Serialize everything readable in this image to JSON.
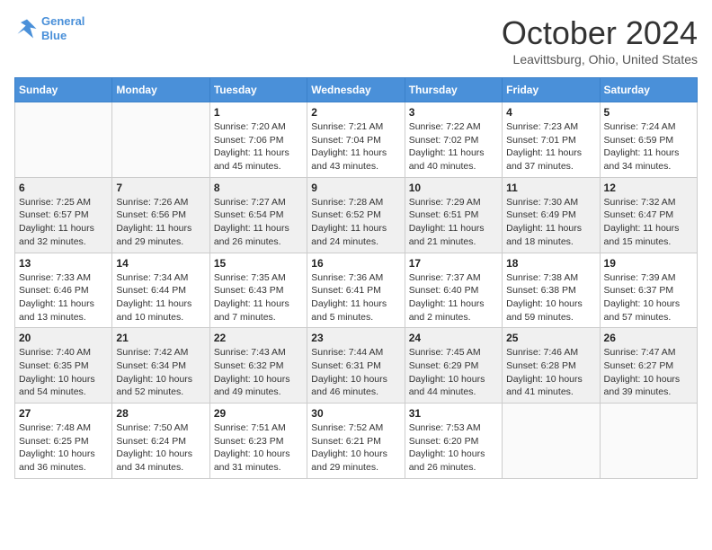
{
  "header": {
    "logo_line1": "General",
    "logo_line2": "Blue",
    "month_title": "October 2024",
    "location": "Leavittsburg, Ohio, United States"
  },
  "days_of_week": [
    "Sunday",
    "Monday",
    "Tuesday",
    "Wednesday",
    "Thursday",
    "Friday",
    "Saturday"
  ],
  "weeks": [
    [
      {
        "day": "",
        "info": ""
      },
      {
        "day": "",
        "info": ""
      },
      {
        "day": "1",
        "info": "Sunrise: 7:20 AM\nSunset: 7:06 PM\nDaylight: 11 hours and 45 minutes."
      },
      {
        "day": "2",
        "info": "Sunrise: 7:21 AM\nSunset: 7:04 PM\nDaylight: 11 hours and 43 minutes."
      },
      {
        "day": "3",
        "info": "Sunrise: 7:22 AM\nSunset: 7:02 PM\nDaylight: 11 hours and 40 minutes."
      },
      {
        "day": "4",
        "info": "Sunrise: 7:23 AM\nSunset: 7:01 PM\nDaylight: 11 hours and 37 minutes."
      },
      {
        "day": "5",
        "info": "Sunrise: 7:24 AM\nSunset: 6:59 PM\nDaylight: 11 hours and 34 minutes."
      }
    ],
    [
      {
        "day": "6",
        "info": "Sunrise: 7:25 AM\nSunset: 6:57 PM\nDaylight: 11 hours and 32 minutes."
      },
      {
        "day": "7",
        "info": "Sunrise: 7:26 AM\nSunset: 6:56 PM\nDaylight: 11 hours and 29 minutes."
      },
      {
        "day": "8",
        "info": "Sunrise: 7:27 AM\nSunset: 6:54 PM\nDaylight: 11 hours and 26 minutes."
      },
      {
        "day": "9",
        "info": "Sunrise: 7:28 AM\nSunset: 6:52 PM\nDaylight: 11 hours and 24 minutes."
      },
      {
        "day": "10",
        "info": "Sunrise: 7:29 AM\nSunset: 6:51 PM\nDaylight: 11 hours and 21 minutes."
      },
      {
        "day": "11",
        "info": "Sunrise: 7:30 AM\nSunset: 6:49 PM\nDaylight: 11 hours and 18 minutes."
      },
      {
        "day": "12",
        "info": "Sunrise: 7:32 AM\nSunset: 6:47 PM\nDaylight: 11 hours and 15 minutes."
      }
    ],
    [
      {
        "day": "13",
        "info": "Sunrise: 7:33 AM\nSunset: 6:46 PM\nDaylight: 11 hours and 13 minutes."
      },
      {
        "day": "14",
        "info": "Sunrise: 7:34 AM\nSunset: 6:44 PM\nDaylight: 11 hours and 10 minutes."
      },
      {
        "day": "15",
        "info": "Sunrise: 7:35 AM\nSunset: 6:43 PM\nDaylight: 11 hours and 7 minutes."
      },
      {
        "day": "16",
        "info": "Sunrise: 7:36 AM\nSunset: 6:41 PM\nDaylight: 11 hours and 5 minutes."
      },
      {
        "day": "17",
        "info": "Sunrise: 7:37 AM\nSunset: 6:40 PM\nDaylight: 11 hours and 2 minutes."
      },
      {
        "day": "18",
        "info": "Sunrise: 7:38 AM\nSunset: 6:38 PM\nDaylight: 10 hours and 59 minutes."
      },
      {
        "day": "19",
        "info": "Sunrise: 7:39 AM\nSunset: 6:37 PM\nDaylight: 10 hours and 57 minutes."
      }
    ],
    [
      {
        "day": "20",
        "info": "Sunrise: 7:40 AM\nSunset: 6:35 PM\nDaylight: 10 hours and 54 minutes."
      },
      {
        "day": "21",
        "info": "Sunrise: 7:42 AM\nSunset: 6:34 PM\nDaylight: 10 hours and 52 minutes."
      },
      {
        "day": "22",
        "info": "Sunrise: 7:43 AM\nSunset: 6:32 PM\nDaylight: 10 hours and 49 minutes."
      },
      {
        "day": "23",
        "info": "Sunrise: 7:44 AM\nSunset: 6:31 PM\nDaylight: 10 hours and 46 minutes."
      },
      {
        "day": "24",
        "info": "Sunrise: 7:45 AM\nSunset: 6:29 PM\nDaylight: 10 hours and 44 minutes."
      },
      {
        "day": "25",
        "info": "Sunrise: 7:46 AM\nSunset: 6:28 PM\nDaylight: 10 hours and 41 minutes."
      },
      {
        "day": "26",
        "info": "Sunrise: 7:47 AM\nSunset: 6:27 PM\nDaylight: 10 hours and 39 minutes."
      }
    ],
    [
      {
        "day": "27",
        "info": "Sunrise: 7:48 AM\nSunset: 6:25 PM\nDaylight: 10 hours and 36 minutes."
      },
      {
        "day": "28",
        "info": "Sunrise: 7:50 AM\nSunset: 6:24 PM\nDaylight: 10 hours and 34 minutes."
      },
      {
        "day": "29",
        "info": "Sunrise: 7:51 AM\nSunset: 6:23 PM\nDaylight: 10 hours and 31 minutes."
      },
      {
        "day": "30",
        "info": "Sunrise: 7:52 AM\nSunset: 6:21 PM\nDaylight: 10 hours and 29 minutes."
      },
      {
        "day": "31",
        "info": "Sunrise: 7:53 AM\nSunset: 6:20 PM\nDaylight: 10 hours and 26 minutes."
      },
      {
        "day": "",
        "info": ""
      },
      {
        "day": "",
        "info": ""
      }
    ]
  ]
}
